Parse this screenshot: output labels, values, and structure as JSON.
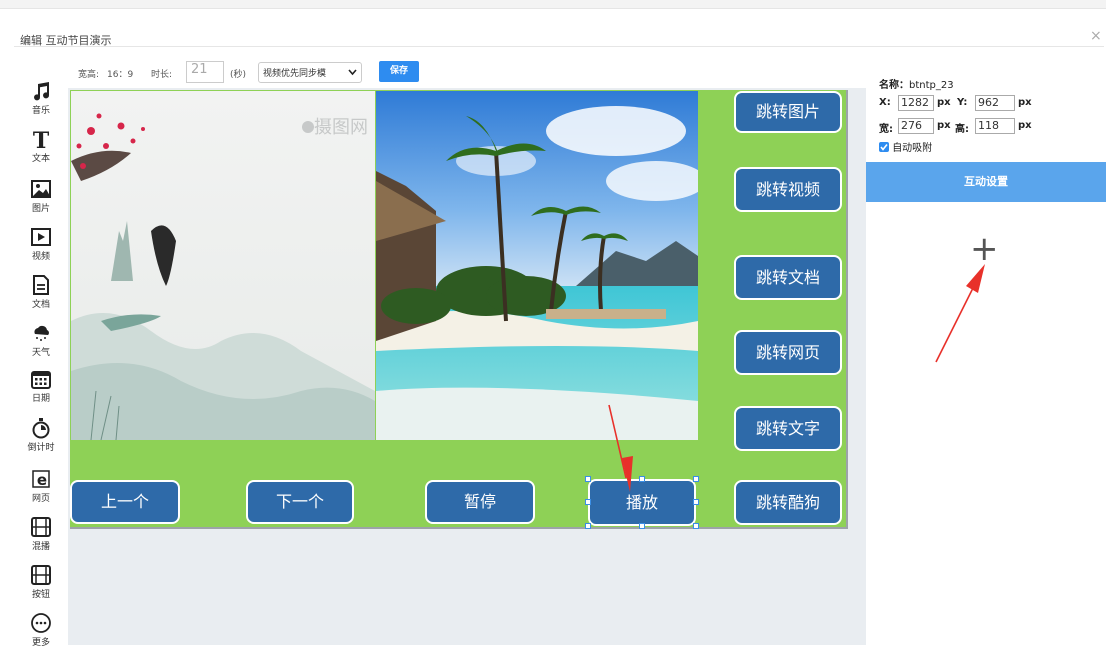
{
  "dialog": {
    "title": "编辑 互动节目演示",
    "close": "×"
  },
  "toolbar": {
    "ratio_label": "宽高:",
    "ratio_value": "16：9",
    "duration_label": "时长:",
    "duration_value": "21",
    "duration_unit": "(秒)",
    "sync_option": "视频优先同步模",
    "save_label": "保存"
  },
  "tools": [
    {
      "label": "音乐",
      "icon": "music-note-icon"
    },
    {
      "label": "文本",
      "icon": "text-t-icon"
    },
    {
      "label": "图片",
      "icon": "image-icon"
    },
    {
      "label": "视频",
      "icon": "video-play-icon"
    },
    {
      "label": "文档",
      "icon": "document-icon"
    },
    {
      "label": "天气",
      "icon": "weather-cloud-icon"
    },
    {
      "label": "日期",
      "icon": "calendar-icon"
    },
    {
      "label": "倒计时",
      "icon": "stopwatch-icon"
    },
    {
      "label": "网页",
      "icon": "web-ie-icon"
    },
    {
      "label": "混播",
      "icon": "film-icon"
    },
    {
      "label": "按钮",
      "icon": "button-film-icon"
    },
    {
      "label": "更多",
      "icon": "more-dots-icon"
    }
  ],
  "stage": {
    "watermark": "摄图网",
    "side_buttons": [
      "跳转图片",
      "跳转视频",
      "跳转文档",
      "跳转网页",
      "跳转文字",
      "跳转酷狗"
    ],
    "bottom_buttons": [
      "上一个",
      "下一个",
      "暂停",
      "播放"
    ]
  },
  "properties": {
    "name_label": "名称：",
    "name_value": "btntp_23",
    "x_label": "X:",
    "x_value": "1282",
    "y_label": "Y:",
    "y_value": "962",
    "w_label": "宽:",
    "w_value": "276",
    "h_label": "高:",
    "h_value": "118",
    "unit": "px",
    "snap_label": "自动吸附",
    "snap_checked": true,
    "interact_label": "互动设置",
    "add_symbol": "+"
  },
  "colors": {
    "stage_green": "#8ed156",
    "button_blue": "#2e6aa9",
    "accent_blue": "#2e8cf0",
    "panel_blue": "#5aa5ec",
    "annotation_red": "#e8312a"
  }
}
